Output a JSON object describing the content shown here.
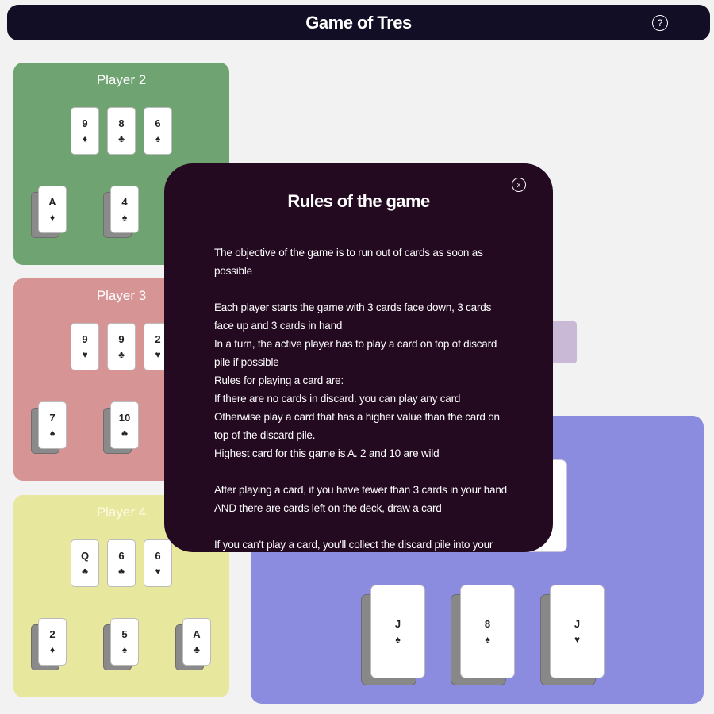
{
  "header": {
    "title": "Game of Tres",
    "help_label": "?"
  },
  "players": {
    "p2": {
      "name": "Player 2",
      "hand": [
        {
          "rank": "9",
          "suit": "♦"
        },
        {
          "rank": "8",
          "suit": "♣"
        },
        {
          "rank": "6",
          "suit": "♠"
        }
      ],
      "table": [
        {
          "rank": "A",
          "suit": "♦"
        },
        {
          "rank": "4",
          "suit": "♠"
        }
      ]
    },
    "p3": {
      "name": "Player 3",
      "hand": [
        {
          "rank": "9",
          "suit": "♥"
        },
        {
          "rank": "9",
          "suit": "♣"
        },
        {
          "rank": "2",
          "suit": "♥"
        }
      ],
      "table": [
        {
          "rank": "7",
          "suit": "♠"
        },
        {
          "rank": "10",
          "suit": "♣"
        }
      ]
    },
    "p4": {
      "name": "Player 4",
      "hand": [
        {
          "rank": "Q",
          "suit": "♣"
        },
        {
          "rank": "6",
          "suit": "♣"
        },
        {
          "rank": "6",
          "suit": "♥"
        }
      ],
      "table": [
        {
          "rank": "2",
          "suit": "♦"
        },
        {
          "rank": "5",
          "suit": "♠"
        },
        {
          "rank": "A",
          "suit": "♣"
        }
      ]
    },
    "p1": {
      "table": [
        {
          "rank": "J",
          "suit": "♠"
        },
        {
          "rank": "8",
          "suit": "♠"
        },
        {
          "rank": "J",
          "suit": "♥"
        }
      ]
    }
  },
  "modal": {
    "title": "Rules of the game",
    "close_label": "x",
    "paragraphs": [
      "The objective of the game is to run out of cards as soon as possible",
      "",
      "Each player starts the game with 3 cards face down, 3 cards face up and 3 cards in hand",
      "In a turn, the active player has to play a card on top of discard pile if possible",
      "Rules for playing a card are:",
      "If there are no cards in discard. you can play any card",
      "Otherwise play a card that has a higher value than the card on top of the discard pile.",
      "Highest card for this game is A. 2 and 10 are wild",
      "",
      "After playing a card, if you have fewer than 3 cards in your hand AND there are cards left on the deck, draw a card",
      "",
      "If you can't play a card, you'll collect the discard pile into your"
    ]
  },
  "colors": {
    "header_bg": "#110e26",
    "player2_bg": "#6fa371",
    "player3_bg": "#d79495",
    "player4_bg": "#e8e79e",
    "player1_bg": "#8b8be0",
    "modal_bg": "#240a21"
  }
}
